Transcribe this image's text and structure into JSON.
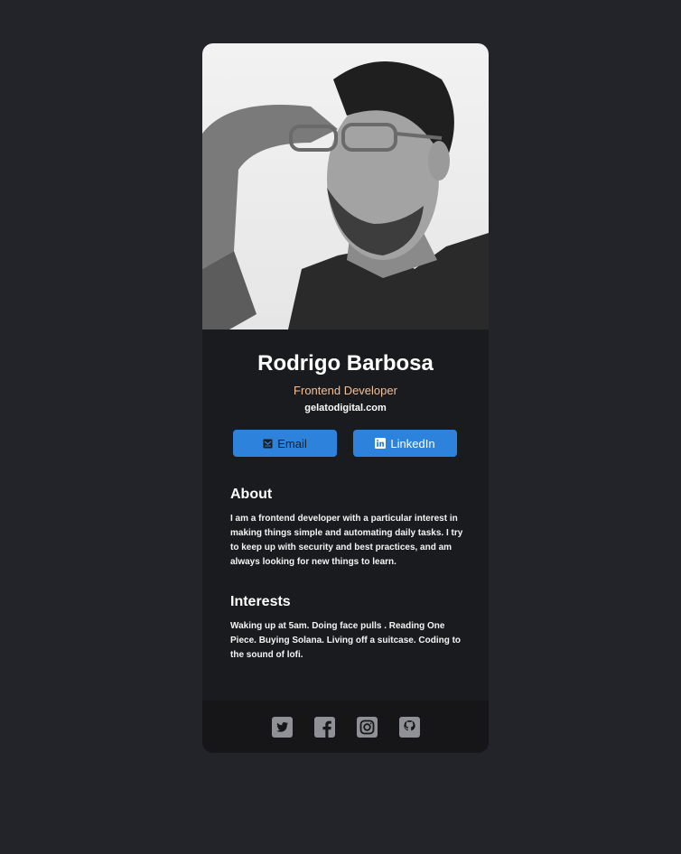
{
  "profile": {
    "name": "Rodrigo Barbosa",
    "title": "Frontend Developer",
    "website": "gelatodigital.com"
  },
  "buttons": {
    "email_label": "Email",
    "linkedin_label": "LinkedIn"
  },
  "about": {
    "heading": "About",
    "text": "I am a frontend developer with a particular interest in making things simple and automating daily tasks. I try to keep up with security and best practices, and am always looking for new things to learn."
  },
  "interests": {
    "heading": "Interests",
    "text": "Waking up at 5am. Doing face pulls . Reading One Piece. Buying Solana. Living off a suitcase. Coding to the sound of lofi."
  },
  "footer": {
    "icons": [
      "twitter-icon",
      "facebook-icon",
      "instagram-icon",
      "github-icon"
    ]
  },
  "colors": {
    "background": "#23242a",
    "card": "#1a1b1e",
    "footer": "#161619",
    "accent_button": "#2d83db",
    "title_text": "#f3bf99",
    "social_icon": "#8f9197"
  }
}
